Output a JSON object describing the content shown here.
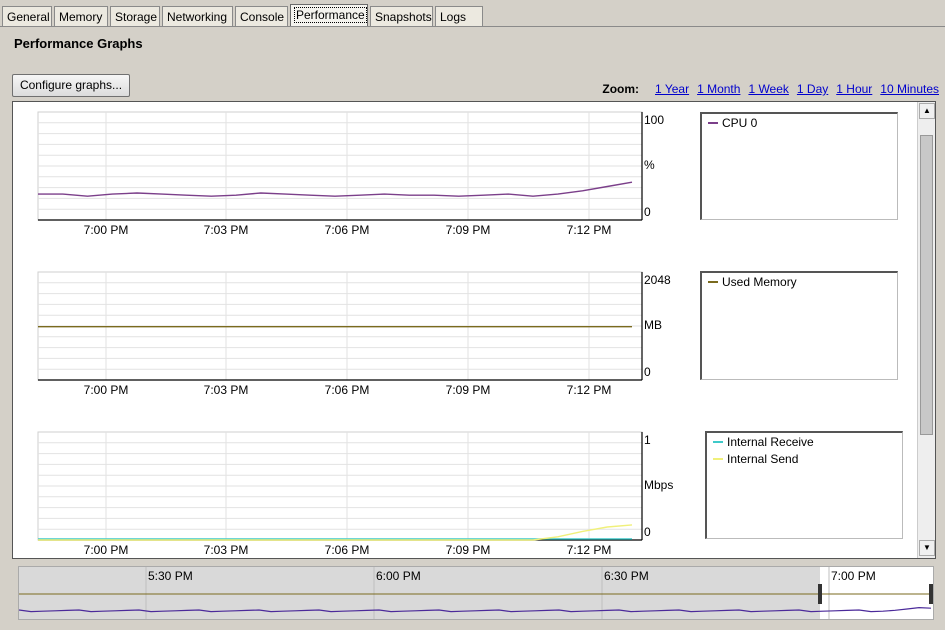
{
  "tabs": [
    {
      "label": "General",
      "active": false
    },
    {
      "label": "Memory",
      "active": false
    },
    {
      "label": "Storage",
      "active": false
    },
    {
      "label": "Networking",
      "active": false
    },
    {
      "label": "Console",
      "active": false
    },
    {
      "label": "Performance",
      "active": true
    },
    {
      "label": "Snapshots",
      "active": false
    },
    {
      "label": "Logs",
      "active": false
    }
  ],
  "page_title": "Performance Graphs",
  "configure_button": "Configure graphs...",
  "zoom": {
    "label": "Zoom:",
    "links": [
      "1 Year",
      "1 Month",
      "1 Week",
      "1 Day",
      "1 Hour",
      "10 Minutes"
    ]
  },
  "x_ticks": [
    "7:00 PM",
    "7:03 PM",
    "7:06 PM",
    "7:09 PM",
    "7:12 PM"
  ],
  "chart_data": [
    {
      "type": "line",
      "y_labels": [
        "100",
        "%",
        "0"
      ],
      "ylim": [
        0,
        100
      ],
      "grid": true,
      "legend_placement": "right",
      "series": [
        {
          "name": "CPU 0",
          "color": "#7b3f8a",
          "values": [
            24,
            24,
            22,
            24,
            25,
            24,
            23,
            22,
            23,
            25,
            24,
            23,
            22,
            23,
            24,
            23,
            23,
            22,
            23,
            24,
            22,
            24,
            27,
            31,
            35
          ]
        }
      ]
    },
    {
      "type": "line",
      "y_labels": [
        "2048",
        "MB",
        "0"
      ],
      "ylim": [
        0,
        2048
      ],
      "grid": true,
      "legend_placement": "right",
      "series": [
        {
          "name": "Used Memory",
          "color": "#7a6a1e",
          "values": [
            1010,
            1010,
            1010,
            1010,
            1010,
            1010,
            1010,
            1010,
            1010,
            1010,
            1010,
            1010,
            1010,
            1010,
            1010,
            1010,
            1010,
            1010,
            1010,
            1010,
            1010,
            1010,
            1010,
            1010,
            1010
          ]
        }
      ]
    },
    {
      "type": "line",
      "y_labels": [
        "1",
        "Mbps",
        "0"
      ],
      "ylim": [
        0,
        1
      ],
      "grid": true,
      "legend_placement": "right",
      "series": [
        {
          "name": "Internal Receive",
          "color": "#3fc9c9",
          "values": [
            0.01,
            0.01,
            0.01,
            0.01,
            0.01,
            0.01,
            0.01,
            0.01,
            0.01,
            0.01,
            0.01,
            0.01,
            0.01,
            0.01,
            0.01,
            0.01,
            0.01,
            0.01,
            0.01,
            0.01,
            0.01,
            0.01,
            0.01,
            0.01,
            0.01
          ]
        },
        {
          "name": "Internal Send",
          "color": "#f0f07a",
          "values": [
            0,
            0,
            0,
            0,
            0,
            0,
            0,
            0,
            0,
            0,
            0,
            0,
            0,
            0,
            0,
            0,
            0,
            0,
            0,
            0,
            0,
            0.03,
            0.08,
            0.12,
            0.14
          ]
        }
      ]
    }
  ],
  "overview": {
    "x_ticks": [
      "5:30 PM",
      "6:00 PM",
      "6:30 PM",
      "7:00 PM"
    ]
  },
  "colors": {
    "background": "#d4d0c8",
    "link": "#0000cc",
    "grid": "#e2e2e2"
  }
}
